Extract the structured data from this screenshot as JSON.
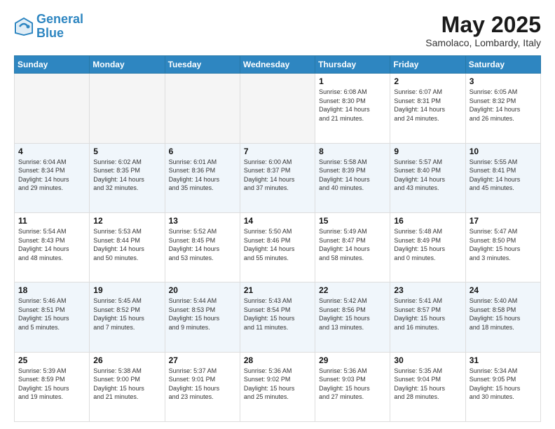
{
  "header": {
    "logo_line1": "General",
    "logo_line2": "Blue",
    "month": "May 2025",
    "location": "Samolaco, Lombardy, Italy"
  },
  "weekdays": [
    "Sunday",
    "Monday",
    "Tuesday",
    "Wednesday",
    "Thursday",
    "Friday",
    "Saturday"
  ],
  "weeks": [
    [
      {
        "day": "",
        "info": ""
      },
      {
        "day": "",
        "info": ""
      },
      {
        "day": "",
        "info": ""
      },
      {
        "day": "",
        "info": ""
      },
      {
        "day": "1",
        "info": "Sunrise: 6:08 AM\nSunset: 8:30 PM\nDaylight: 14 hours\nand 21 minutes."
      },
      {
        "day": "2",
        "info": "Sunrise: 6:07 AM\nSunset: 8:31 PM\nDaylight: 14 hours\nand 24 minutes."
      },
      {
        "day": "3",
        "info": "Sunrise: 6:05 AM\nSunset: 8:32 PM\nDaylight: 14 hours\nand 26 minutes."
      }
    ],
    [
      {
        "day": "4",
        "info": "Sunrise: 6:04 AM\nSunset: 8:34 PM\nDaylight: 14 hours\nand 29 minutes."
      },
      {
        "day": "5",
        "info": "Sunrise: 6:02 AM\nSunset: 8:35 PM\nDaylight: 14 hours\nand 32 minutes."
      },
      {
        "day": "6",
        "info": "Sunrise: 6:01 AM\nSunset: 8:36 PM\nDaylight: 14 hours\nand 35 minutes."
      },
      {
        "day": "7",
        "info": "Sunrise: 6:00 AM\nSunset: 8:37 PM\nDaylight: 14 hours\nand 37 minutes."
      },
      {
        "day": "8",
        "info": "Sunrise: 5:58 AM\nSunset: 8:39 PM\nDaylight: 14 hours\nand 40 minutes."
      },
      {
        "day": "9",
        "info": "Sunrise: 5:57 AM\nSunset: 8:40 PM\nDaylight: 14 hours\nand 43 minutes."
      },
      {
        "day": "10",
        "info": "Sunrise: 5:55 AM\nSunset: 8:41 PM\nDaylight: 14 hours\nand 45 minutes."
      }
    ],
    [
      {
        "day": "11",
        "info": "Sunrise: 5:54 AM\nSunset: 8:43 PM\nDaylight: 14 hours\nand 48 minutes."
      },
      {
        "day": "12",
        "info": "Sunrise: 5:53 AM\nSunset: 8:44 PM\nDaylight: 14 hours\nand 50 minutes."
      },
      {
        "day": "13",
        "info": "Sunrise: 5:52 AM\nSunset: 8:45 PM\nDaylight: 14 hours\nand 53 minutes."
      },
      {
        "day": "14",
        "info": "Sunrise: 5:50 AM\nSunset: 8:46 PM\nDaylight: 14 hours\nand 55 minutes."
      },
      {
        "day": "15",
        "info": "Sunrise: 5:49 AM\nSunset: 8:47 PM\nDaylight: 14 hours\nand 58 minutes."
      },
      {
        "day": "16",
        "info": "Sunrise: 5:48 AM\nSunset: 8:49 PM\nDaylight: 15 hours\nand 0 minutes."
      },
      {
        "day": "17",
        "info": "Sunrise: 5:47 AM\nSunset: 8:50 PM\nDaylight: 15 hours\nand 3 minutes."
      }
    ],
    [
      {
        "day": "18",
        "info": "Sunrise: 5:46 AM\nSunset: 8:51 PM\nDaylight: 15 hours\nand 5 minutes."
      },
      {
        "day": "19",
        "info": "Sunrise: 5:45 AM\nSunset: 8:52 PM\nDaylight: 15 hours\nand 7 minutes."
      },
      {
        "day": "20",
        "info": "Sunrise: 5:44 AM\nSunset: 8:53 PM\nDaylight: 15 hours\nand 9 minutes."
      },
      {
        "day": "21",
        "info": "Sunrise: 5:43 AM\nSunset: 8:54 PM\nDaylight: 15 hours\nand 11 minutes."
      },
      {
        "day": "22",
        "info": "Sunrise: 5:42 AM\nSunset: 8:56 PM\nDaylight: 15 hours\nand 13 minutes."
      },
      {
        "day": "23",
        "info": "Sunrise: 5:41 AM\nSunset: 8:57 PM\nDaylight: 15 hours\nand 16 minutes."
      },
      {
        "day": "24",
        "info": "Sunrise: 5:40 AM\nSunset: 8:58 PM\nDaylight: 15 hours\nand 18 minutes."
      }
    ],
    [
      {
        "day": "25",
        "info": "Sunrise: 5:39 AM\nSunset: 8:59 PM\nDaylight: 15 hours\nand 19 minutes."
      },
      {
        "day": "26",
        "info": "Sunrise: 5:38 AM\nSunset: 9:00 PM\nDaylight: 15 hours\nand 21 minutes."
      },
      {
        "day": "27",
        "info": "Sunrise: 5:37 AM\nSunset: 9:01 PM\nDaylight: 15 hours\nand 23 minutes."
      },
      {
        "day": "28",
        "info": "Sunrise: 5:36 AM\nSunset: 9:02 PM\nDaylight: 15 hours\nand 25 minutes."
      },
      {
        "day": "29",
        "info": "Sunrise: 5:36 AM\nSunset: 9:03 PM\nDaylight: 15 hours\nand 27 minutes."
      },
      {
        "day": "30",
        "info": "Sunrise: 5:35 AM\nSunset: 9:04 PM\nDaylight: 15 hours\nand 28 minutes."
      },
      {
        "day": "31",
        "info": "Sunrise: 5:34 AM\nSunset: 9:05 PM\nDaylight: 15 hours\nand 30 minutes."
      }
    ]
  ]
}
